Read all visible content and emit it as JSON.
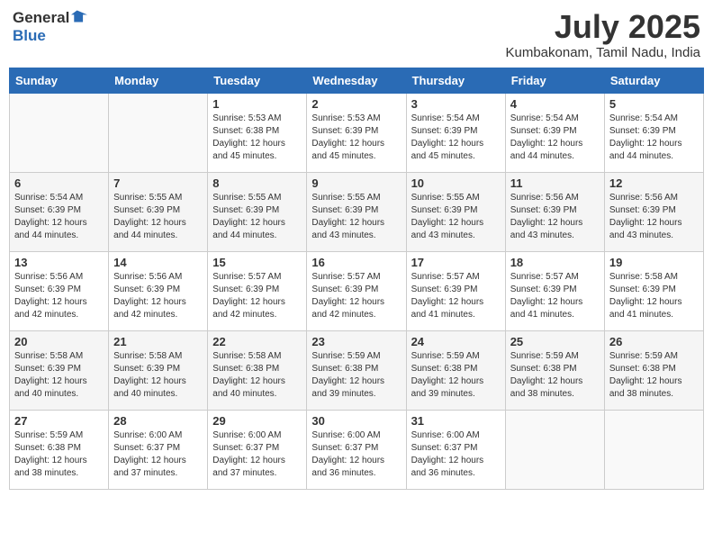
{
  "logo": {
    "line1": "General",
    "line2": "Blue"
  },
  "title": "July 2025",
  "location": "Kumbakonam, Tamil Nadu, India",
  "weekdays": [
    "Sunday",
    "Monday",
    "Tuesday",
    "Wednesday",
    "Thursday",
    "Friday",
    "Saturday"
  ],
  "weeks": [
    [
      {
        "day": "",
        "info": ""
      },
      {
        "day": "",
        "info": ""
      },
      {
        "day": "1",
        "info": "Sunrise: 5:53 AM\nSunset: 6:38 PM\nDaylight: 12 hours\nand 45 minutes."
      },
      {
        "day": "2",
        "info": "Sunrise: 5:53 AM\nSunset: 6:39 PM\nDaylight: 12 hours\nand 45 minutes."
      },
      {
        "day": "3",
        "info": "Sunrise: 5:54 AM\nSunset: 6:39 PM\nDaylight: 12 hours\nand 45 minutes."
      },
      {
        "day": "4",
        "info": "Sunrise: 5:54 AM\nSunset: 6:39 PM\nDaylight: 12 hours\nand 44 minutes."
      },
      {
        "day": "5",
        "info": "Sunrise: 5:54 AM\nSunset: 6:39 PM\nDaylight: 12 hours\nand 44 minutes."
      }
    ],
    [
      {
        "day": "6",
        "info": "Sunrise: 5:54 AM\nSunset: 6:39 PM\nDaylight: 12 hours\nand 44 minutes."
      },
      {
        "day": "7",
        "info": "Sunrise: 5:55 AM\nSunset: 6:39 PM\nDaylight: 12 hours\nand 44 minutes."
      },
      {
        "day": "8",
        "info": "Sunrise: 5:55 AM\nSunset: 6:39 PM\nDaylight: 12 hours\nand 44 minutes."
      },
      {
        "day": "9",
        "info": "Sunrise: 5:55 AM\nSunset: 6:39 PM\nDaylight: 12 hours\nand 43 minutes."
      },
      {
        "day": "10",
        "info": "Sunrise: 5:55 AM\nSunset: 6:39 PM\nDaylight: 12 hours\nand 43 minutes."
      },
      {
        "day": "11",
        "info": "Sunrise: 5:56 AM\nSunset: 6:39 PM\nDaylight: 12 hours\nand 43 minutes."
      },
      {
        "day": "12",
        "info": "Sunrise: 5:56 AM\nSunset: 6:39 PM\nDaylight: 12 hours\nand 43 minutes."
      }
    ],
    [
      {
        "day": "13",
        "info": "Sunrise: 5:56 AM\nSunset: 6:39 PM\nDaylight: 12 hours\nand 42 minutes."
      },
      {
        "day": "14",
        "info": "Sunrise: 5:56 AM\nSunset: 6:39 PM\nDaylight: 12 hours\nand 42 minutes."
      },
      {
        "day": "15",
        "info": "Sunrise: 5:57 AM\nSunset: 6:39 PM\nDaylight: 12 hours\nand 42 minutes."
      },
      {
        "day": "16",
        "info": "Sunrise: 5:57 AM\nSunset: 6:39 PM\nDaylight: 12 hours\nand 42 minutes."
      },
      {
        "day": "17",
        "info": "Sunrise: 5:57 AM\nSunset: 6:39 PM\nDaylight: 12 hours\nand 41 minutes."
      },
      {
        "day": "18",
        "info": "Sunrise: 5:57 AM\nSunset: 6:39 PM\nDaylight: 12 hours\nand 41 minutes."
      },
      {
        "day": "19",
        "info": "Sunrise: 5:58 AM\nSunset: 6:39 PM\nDaylight: 12 hours\nand 41 minutes."
      }
    ],
    [
      {
        "day": "20",
        "info": "Sunrise: 5:58 AM\nSunset: 6:39 PM\nDaylight: 12 hours\nand 40 minutes."
      },
      {
        "day": "21",
        "info": "Sunrise: 5:58 AM\nSunset: 6:39 PM\nDaylight: 12 hours\nand 40 minutes."
      },
      {
        "day": "22",
        "info": "Sunrise: 5:58 AM\nSunset: 6:38 PM\nDaylight: 12 hours\nand 40 minutes."
      },
      {
        "day": "23",
        "info": "Sunrise: 5:59 AM\nSunset: 6:38 PM\nDaylight: 12 hours\nand 39 minutes."
      },
      {
        "day": "24",
        "info": "Sunrise: 5:59 AM\nSunset: 6:38 PM\nDaylight: 12 hours\nand 39 minutes."
      },
      {
        "day": "25",
        "info": "Sunrise: 5:59 AM\nSunset: 6:38 PM\nDaylight: 12 hours\nand 38 minutes."
      },
      {
        "day": "26",
        "info": "Sunrise: 5:59 AM\nSunset: 6:38 PM\nDaylight: 12 hours\nand 38 minutes."
      }
    ],
    [
      {
        "day": "27",
        "info": "Sunrise: 5:59 AM\nSunset: 6:38 PM\nDaylight: 12 hours\nand 38 minutes."
      },
      {
        "day": "28",
        "info": "Sunrise: 6:00 AM\nSunset: 6:37 PM\nDaylight: 12 hours\nand 37 minutes."
      },
      {
        "day": "29",
        "info": "Sunrise: 6:00 AM\nSunset: 6:37 PM\nDaylight: 12 hours\nand 37 minutes."
      },
      {
        "day": "30",
        "info": "Sunrise: 6:00 AM\nSunset: 6:37 PM\nDaylight: 12 hours\nand 36 minutes."
      },
      {
        "day": "31",
        "info": "Sunrise: 6:00 AM\nSunset: 6:37 PM\nDaylight: 12 hours\nand 36 minutes."
      },
      {
        "day": "",
        "info": ""
      },
      {
        "day": "",
        "info": ""
      }
    ]
  ]
}
